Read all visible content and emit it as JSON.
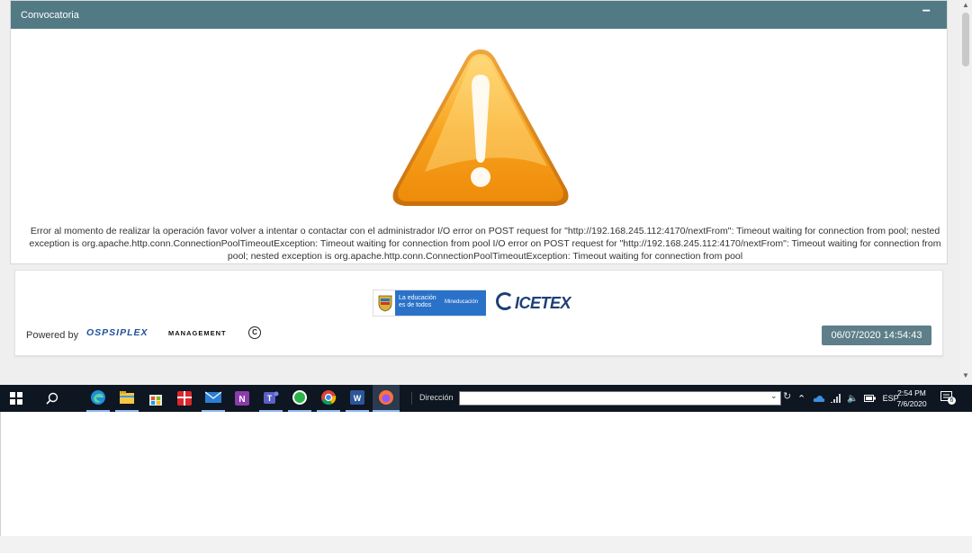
{
  "panel": {
    "title": "Convocatoria",
    "collapse_symbol": "−",
    "error_message": "Error al momento de realizar la operación favor volver a intentar o contactar con el administrador I/O error on POST request for \"http://192.168.245.112:4170/nextFrom\": Timeout waiting for connection from pool; nested exception is org.apache.http.conn.ConnectionPoolTimeoutException: Timeout waiting for connection from pool I/O error on POST request for \"http://192.168.245.112:4170/nextFrom\": Timeout waiting for connection from pool; nested exception is org.apache.http.conn.ConnectionPoolTimeoutException: Timeout waiting for connection from pool"
  },
  "footer": {
    "mineducacion_line1": "La educación es de todos",
    "mineducacion_line2": "Mineducación",
    "icetex_text": "ICETEX",
    "powered_label": "Powered by",
    "osp_logo_text": "OSPSIPLEX",
    "osp_mgmt_text": "MANAGEMENT",
    "copyright_symbol": "C",
    "timestamp": "06/07/2020 14:54:43"
  },
  "taskbar": {
    "address_label": "Dirección",
    "language": "ESP",
    "time": "2:54 PM",
    "date": "7/6/2020",
    "notification_count": "6",
    "apps": [
      "start-icon",
      "search-icon",
      "edge-icon",
      "file-explorer-icon",
      "store-icon",
      "gift-icon",
      "mail-icon",
      "onenote-icon",
      "teams-icon",
      "whatsapp-icon",
      "chrome-icon",
      "word-icon",
      "firefox-icon"
    ]
  },
  "colors": {
    "header": "#527a85",
    "badge": "#5e7f89",
    "taskbar": "#0d1621",
    "warning_orange": "#f39a1a"
  }
}
